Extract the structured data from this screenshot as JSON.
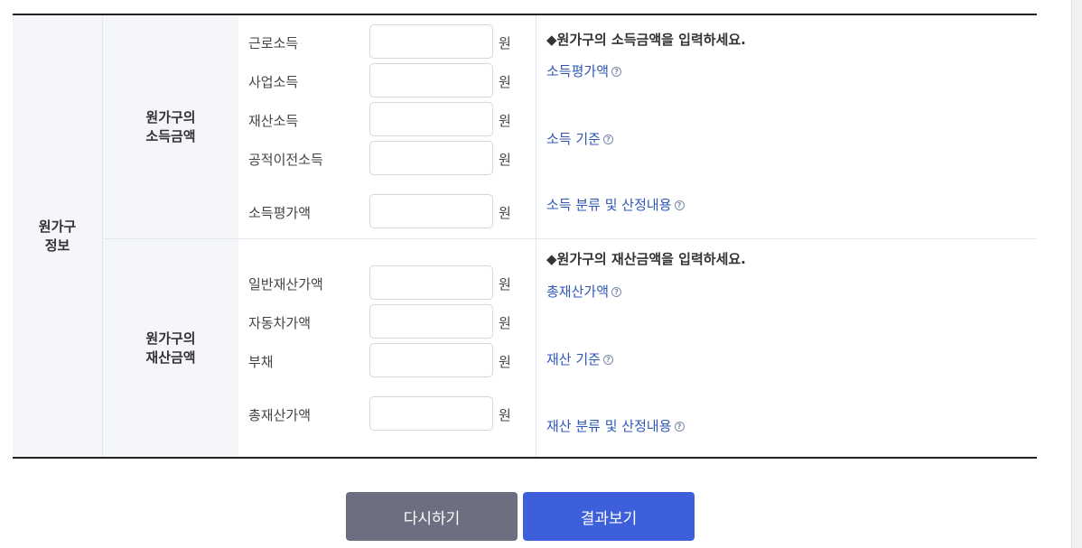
{
  "group_header": "원가구\n정보",
  "income": {
    "header": "원가구의\n소득금액",
    "fields": [
      {
        "label": "근로소득",
        "value": "",
        "unit": "원"
      },
      {
        "label": "사업소득",
        "value": "",
        "unit": "원"
      },
      {
        "label": "재산소득",
        "value": "",
        "unit": "원"
      },
      {
        "label": "공적이전소득",
        "value": "",
        "unit": "원"
      },
      {
        "label": "소득평가액",
        "value": "",
        "unit": "원"
      }
    ],
    "info": {
      "heading": "◆원가구의 소득금액을 입력하세요.",
      "links": [
        "소득평가액",
        "소득 기준",
        "소득 분류 및 산정내용"
      ]
    }
  },
  "asset": {
    "header": "원가구의\n재산금액",
    "fields": [
      {
        "label": "일반재산가액",
        "value": "",
        "unit": "원"
      },
      {
        "label": "자동차가액",
        "value": "",
        "unit": "원"
      },
      {
        "label": "부채",
        "value": "",
        "unit": "원"
      },
      {
        "label": "총재산가액",
        "value": "",
        "unit": "원"
      }
    ],
    "info": {
      "heading": "◆원가구의 재산금액을 입력하세요.",
      "links": [
        "총재산가액",
        "재산 기준",
        "재산 분류 및 산정내용"
      ]
    }
  },
  "help_icon": {
    "name": "question-circle-icon",
    "glyph": "?"
  },
  "buttons": {
    "reset": "다시하기",
    "result": "결과보기"
  },
  "colors": {
    "link": "#2f57b8",
    "reset_button": "#6c6f80",
    "result_button": "#3d5fd9",
    "header_bg": "#f4f6fa"
  }
}
